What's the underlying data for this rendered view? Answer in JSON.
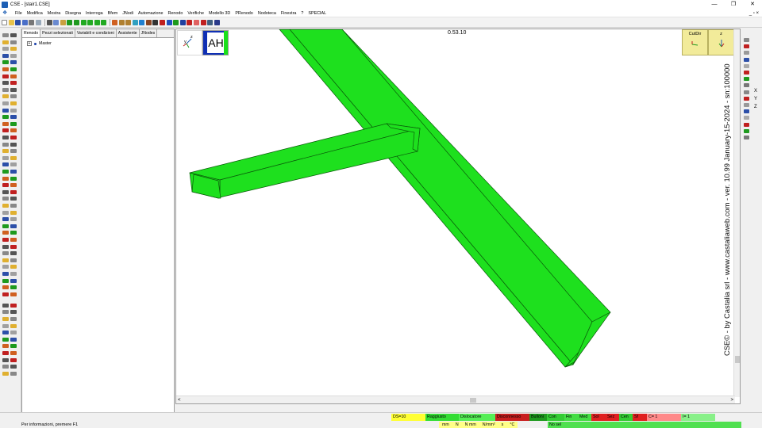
{
  "window": {
    "title": "CSE - [stair1.CSE]",
    "controls": [
      "—",
      "❐",
      "✕"
    ]
  },
  "menu": {
    "items": [
      "File",
      "Modifica",
      "Mostra",
      "Disegna",
      "Interroga",
      "Bfem",
      "JNodi",
      "Automazione",
      "Renodo",
      "Verifiche",
      "Modello 3D",
      "PRenodo",
      "Nodoteca",
      "Finestra",
      "?",
      "SPECIAL"
    ],
    "mdi_controls": "_ ▫ ×"
  },
  "toolbar": {
    "icons": [
      "new-icon",
      "open-icon",
      "save-icon",
      "save-as-icon",
      "print-icon",
      "preview-icon",
      "cut-icon",
      "copy-icon",
      "paste-icon",
      "move-icon",
      "rotate-icon",
      "arrow-up-icon",
      "arrow-down-icon",
      "arrow-left-icon",
      "arrow-right-icon",
      "zoom-window-icon",
      "zoom-in-icon",
      "zoom-out-icon",
      "zoom-all-icon",
      "pan-icon",
      "refresh-icon",
      "render-icon",
      "wireframe-icon",
      "section-icon",
      "layer-icon",
      "snap-icon",
      "measure-icon",
      "filter-icon",
      "dimension-icon",
      "grid-icon",
      "help-pointer-icon"
    ]
  },
  "tree_panel": {
    "tabs": [
      "Renodo",
      "Pezzi selezionati",
      "Variabili e condizioni",
      "Assistente",
      "JNodes"
    ],
    "active_tab": 0,
    "root_label": "Master",
    "expander": "+"
  },
  "viewport": {
    "ah_label": "AH",
    "axis_label_z": "z",
    "axis_label_y": "y",
    "clock": "0.53.10",
    "cutdir_label": "CutDir",
    "z_label": "z",
    "credits": "CSE© - by Castalia srl - www.castaliaweb.com - ver. 10.99 January-15-2024 - sn:100000",
    "member_color": "#1ee01e",
    "member_edge": "#0a5a0a",
    "scroll_left": "<",
    "scroll_right": ">"
  },
  "right_tools": {
    "axis_letters": [
      "X",
      "Y",
      "Z"
    ]
  },
  "status": {
    "cells": [
      {
        "text": "DS=10",
        "color": "#ffff33"
      },
      {
        "text": "Raggiusto",
        "color": "#33dd33"
      },
      {
        "text": "Dislocatore",
        "color": "#55ee55"
      },
      {
        "text": "Disconnesso",
        "color": "#c81e1e"
      },
      {
        "text": "Bulloni",
        "color": "#1e9a1e"
      },
      {
        "text": "Con",
        "color": "#33cc33"
      },
      {
        "text": "Fin",
        "color": "#44dd44"
      },
      {
        "text": "Med",
        "color": "#44dd44"
      },
      {
        "text": "Sol",
        "color": "#e02020"
      },
      {
        "text": "Sez",
        "color": "#e02020"
      },
      {
        "text": "Cen",
        "color": "#33cc33"
      },
      {
        "text": "Sf",
        "color": "#e02020"
      },
      {
        "text": "C= 1",
        "color": "#ff8a8a"
      },
      {
        "text": "I= 1",
        "color": "#88f088"
      }
    ],
    "message": "Per informazioni, premere F1",
    "units": [
      "mm",
      "N",
      "N mm",
      "N/mm²",
      "s",
      "°C"
    ],
    "selection": "No sel"
  }
}
